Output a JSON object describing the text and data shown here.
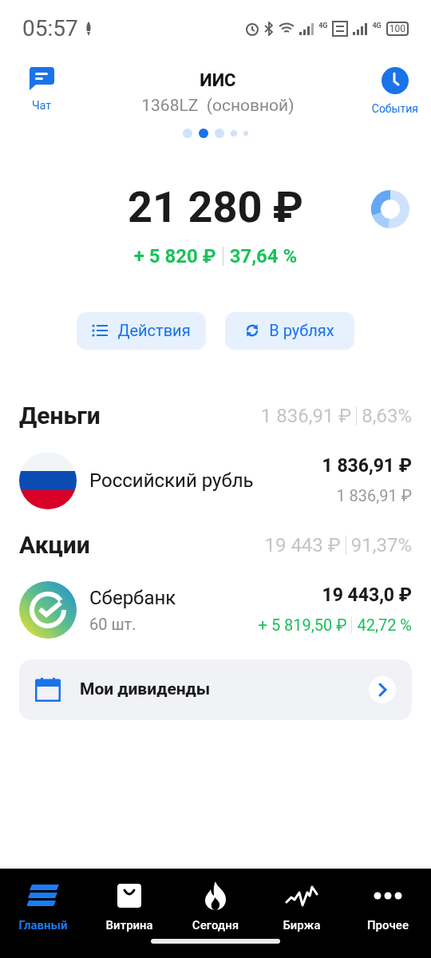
{
  "status_bar": {
    "time": "05:57",
    "battery": "100",
    "network_1": "4G",
    "network_2": "4G"
  },
  "header": {
    "chat_label": "Чат",
    "title": "ИИС",
    "subtitle": "1368LZ  (основной)",
    "events_label": "События"
  },
  "page_dots": [
    {
      "selected": false
    },
    {
      "selected": true
    },
    {
      "selected": false
    },
    {
      "selected": false
    },
    {
      "selected": false
    }
  ],
  "total": {
    "value": "21 280 ₽",
    "change": "+ 5 820 ₽",
    "change_percent": "37,64 %"
  },
  "actions": [
    {
      "kind": "list",
      "label": "Действия"
    },
    {
      "kind": "refresh",
      "label": "В рублях"
    }
  ],
  "sections": [
    {
      "title": "Деньги",
      "sum": "1 836,91 ₽",
      "share": "8,63%",
      "items": [
        {
          "kind": "currency",
          "name": "Российский рубль",
          "value": "1 836,91 ₽",
          "value_secondary": "1 836,91 ₽"
        }
      ]
    },
    {
      "title": "Акции",
      "sum": "19 443 ₽",
      "share": "91,37%",
      "items": [
        {
          "kind": "stock",
          "name": "Сбербанк",
          "quantity": "60 шт.",
          "value": "19 443,0 ₽",
          "change": "+ 5 819,50 ₽",
          "change_percent": "42,72 %"
        }
      ]
    }
  ],
  "dividends": {
    "label": "Мои дивиденды"
  },
  "bottom_nav": [
    {
      "kind": "home",
      "label": "Главный",
      "selected": true
    },
    {
      "kind": "showcase",
      "label": "Витрина",
      "selected": false
    },
    {
      "kind": "today",
      "label": "Сегодня",
      "selected": false
    },
    {
      "kind": "exchange",
      "label": "Биржа",
      "selected": false
    },
    {
      "kind": "more",
      "label": "Прочее",
      "selected": false
    }
  ]
}
